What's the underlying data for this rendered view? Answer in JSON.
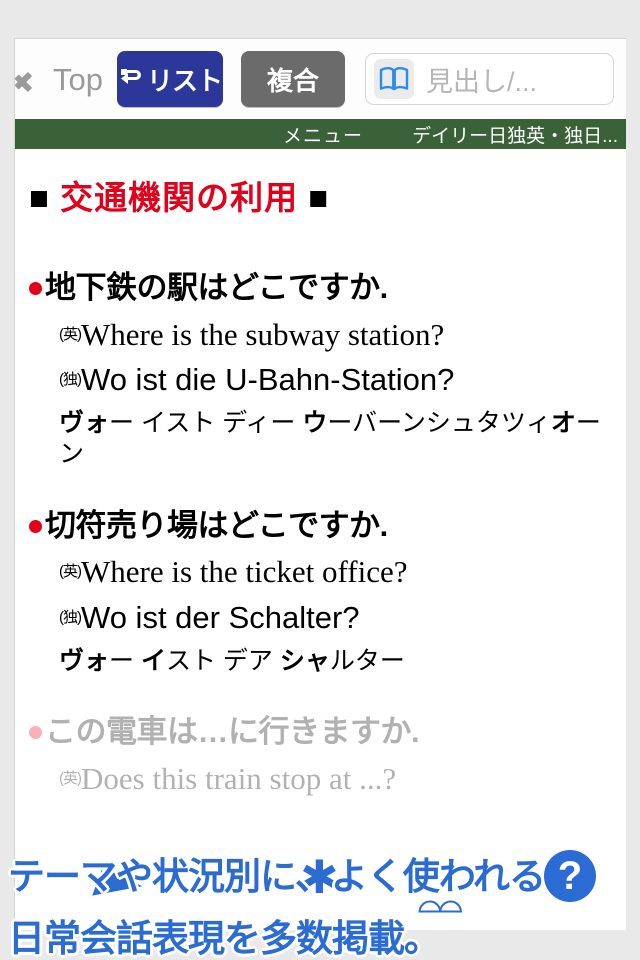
{
  "colors": {
    "accent_blue": "#2b3899",
    "compound_gray": "#6b6b6b",
    "status_green": "#3a6138",
    "heading_red": "#e2001a",
    "promo_blue": "#2a6bd4",
    "back_gray": "#9a9a9a"
  },
  "toolbar": {
    "back_label": "Top",
    "list_button_label": "リスト",
    "compound_button_label": "複合",
    "search_placeholder": "見出し/..."
  },
  "status_bar": {
    "menu_label": "メニュー",
    "dictionary_title": "デイリー日独英・独日..."
  },
  "content": {
    "section_heading": {
      "left_mark": "■",
      "text": "交通機関の利用",
      "right_mark": "■"
    },
    "entries": [
      {
        "japanese": "地下鉄の駅はどこですか.",
        "english_tag": "(英)",
        "english": "Where is the subway station?",
        "german_tag": "(独)",
        "german": "Wo ist die U-Bahn-Station?",
        "kana_parts": [
          {
            "text": "ヴォ",
            "bold": true
          },
          {
            "text": "ー イスト ディー ",
            "bold": false
          },
          {
            "text": "ウ",
            "bold": true
          },
          {
            "text": "ーバーンシュタツィ",
            "bold": false
          },
          {
            "text": "オ",
            "bold": true
          },
          {
            "text": "ーン",
            "bold": false
          }
        ]
      },
      {
        "japanese": "切符売り場はどこですか.",
        "english_tag": "(英)",
        "english": "Where is the ticket office?",
        "german_tag": "(独)",
        "german": "Wo ist der Schalter?",
        "kana_parts": [
          {
            "text": "ヴォ",
            "bold": true
          },
          {
            "text": "ー ",
            "bold": false
          },
          {
            "text": "イ",
            "bold": true
          },
          {
            "text": "スト デア ",
            "bold": false
          },
          {
            "text": "シャ",
            "bold": true
          },
          {
            "text": "ルター",
            "bold": false
          }
        ]
      },
      {
        "japanese": "この電車は…に行きますか.",
        "english_tag": "(英)",
        "english": "Does this train stop at ...?",
        "german_tag": "",
        "german": "",
        "kana_parts": []
      }
    ]
  },
  "promo": {
    "line1": "テーマや状況別に、よく使われる",
    "line2": "日常会話表現を多数掲載。",
    "question_mark": "?"
  }
}
